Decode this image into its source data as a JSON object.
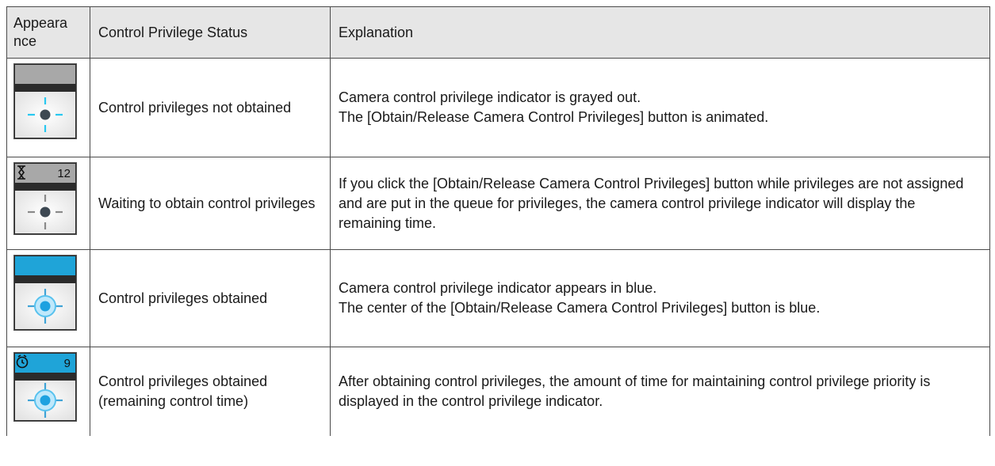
{
  "table": {
    "headers": {
      "appearance": "Appeara nce",
      "status": "Control Privilege Status",
      "explanation": "Explanation"
    },
    "rows": [
      {
        "status": "Control privileges not obtained",
        "explanation_lines": [
          "Camera control privilege indicator is grayed out.",
          "The [Obtain/Release Camera Control Privileges] button is animated."
        ],
        "icon": {
          "name": "control-icon-not-obtained",
          "bar_color": "#a8a8a8",
          "counter": "",
          "glyph": ""
        }
      },
      {
        "status": "Waiting to obtain control privileges",
        "explanation_lines": [
          "If you click the [Obtain/Release Camera Control Privileges] button while privileges are not assigned and are put in the queue for privileges, the camera control privilege indicator will display the remaining time."
        ],
        "icon": {
          "name": "control-icon-waiting",
          "bar_color": "#a8a8a8",
          "counter": "12",
          "glyph": "hourglass"
        }
      },
      {
        "status": "Control privileges obtained",
        "explanation_lines": [
          "Camera control privilege indicator appears in blue.",
          "The center of the [Obtain/Release Camera Control Privileges] button is blue."
        ],
        "icon": {
          "name": "control-icon-obtained",
          "bar_color": "#1fa4d8",
          "counter": "",
          "glyph": ""
        }
      },
      {
        "status": "Control privileges obtained (remaining control time)",
        "explanation_lines": [
          "After obtaining control privileges, the amount of time for maintaining control privilege priority is displayed in the control privilege indicator."
        ],
        "icon": {
          "name": "control-icon-obtained-timer",
          "bar_color": "#1fa4d8",
          "counter": "9",
          "glyph": "clock"
        }
      }
    ]
  }
}
